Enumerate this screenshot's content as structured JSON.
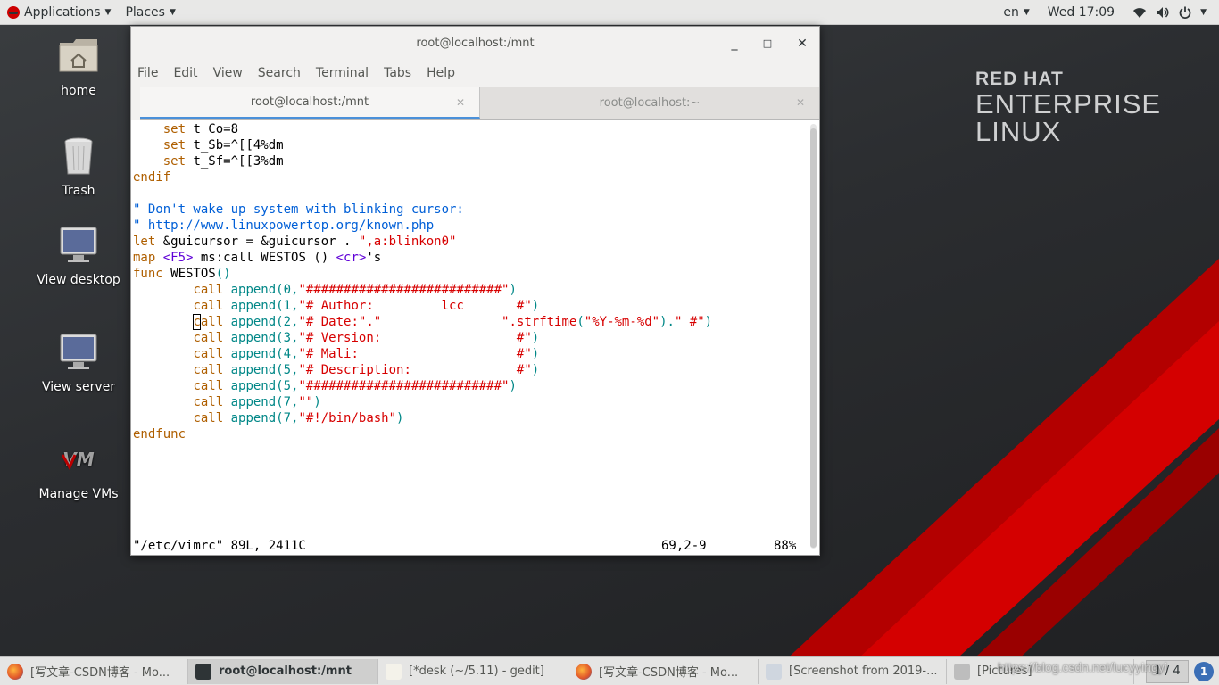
{
  "topbar": {
    "applications": "Applications",
    "places": "Places",
    "language": "en",
    "clock": "Wed 17:09"
  },
  "desktop": {
    "brand": {
      "line1": "RED HAT",
      "line2": "ENTERPRISE",
      "line3": "LINUX"
    },
    "icons": [
      {
        "label": "home",
        "icon": "home-folder-icon"
      },
      {
        "label": "Trash",
        "icon": "trash-icon"
      },
      {
        "label": "View desktop",
        "icon": "monitor-icon"
      },
      {
        "label": "View server",
        "icon": "monitor-icon"
      },
      {
        "label": "Manage VMs",
        "icon": "vm-icon"
      }
    ]
  },
  "terminal": {
    "title": "root@localhost:/mnt",
    "menu": [
      "File",
      "Edit",
      "View",
      "Search",
      "Terminal",
      "Tabs",
      "Help"
    ],
    "tabs": [
      {
        "label": "root@localhost:/mnt",
        "active": true
      },
      {
        "label": "root@localhost:~",
        "active": false
      }
    ],
    "lines": [
      [
        [
          "    ",
          "st"
        ],
        [
          "set",
          "kw"
        ],
        [
          " t_Co=8",
          "st"
        ]
      ],
      [
        [
          "    ",
          "st"
        ],
        [
          "set",
          "kw"
        ],
        [
          " t_Sb=^[[4%dm",
          "st"
        ]
      ],
      [
        [
          "    ",
          "st"
        ],
        [
          "set",
          "kw"
        ],
        [
          " t_Sf=^[[3%dm",
          "st"
        ]
      ],
      [
        [
          "endif",
          "kw"
        ]
      ],
      [
        [
          "",
          "st"
        ]
      ],
      [
        [
          "\" Don't wake up system with blinking cursor:",
          "cm"
        ]
      ],
      [
        [
          "\" http://www.linuxpowertop.org/known.php",
          "cm"
        ]
      ],
      [
        [
          "let",
          "kw"
        ],
        [
          " &guicursor = &guicursor . ",
          "st"
        ],
        [
          "\",a:blinkon0\"",
          "str"
        ]
      ],
      [
        [
          "map",
          "kw"
        ],
        [
          " ",
          "st"
        ],
        [
          "<F5>",
          "sp"
        ],
        [
          " ms:call WESTOS () ",
          "st"
        ],
        [
          "<cr>",
          "sp"
        ],
        [
          "'s",
          "st"
        ]
      ],
      [
        [
          "func",
          "kw"
        ],
        [
          " WESTOS",
          "st"
        ],
        [
          "()",
          "fn"
        ]
      ],
      [
        [
          "        ",
          "st"
        ],
        [
          "call",
          "kw"
        ],
        [
          " ",
          "st"
        ],
        [
          "append",
          "fn"
        ],
        [
          "(0,",
          "fn"
        ],
        [
          "\"##########################\"",
          "str"
        ],
        [
          ")",
          "fn"
        ]
      ],
      [
        [
          "        ",
          "st"
        ],
        [
          "call",
          "kw"
        ],
        [
          " ",
          "st"
        ],
        [
          "append",
          "fn"
        ],
        [
          "(1,",
          "fn"
        ],
        [
          "\"# Author:         lcc       #\"",
          "str"
        ],
        [
          ")",
          "fn"
        ]
      ],
      [
        [
          "        ",
          "st"
        ],
        [
          "call",
          "kw"
        ],
        [
          " ",
          "st"
        ],
        [
          "append",
          "fn"
        ],
        [
          "(2,",
          "fn"
        ],
        [
          "\"# Date:\".\"",
          "str"
        ],
        [
          "                ",
          "st"
        ],
        [
          "\".strftime",
          "str"
        ],
        [
          "(",
          "fn"
        ],
        [
          "\"%Y-%m-%d\"",
          "str"
        ],
        [
          ").",
          "fn"
        ],
        [
          "\" #\"",
          "str"
        ],
        [
          ")",
          "fn"
        ]
      ],
      [
        [
          "        ",
          "st"
        ],
        [
          "call",
          "kw"
        ],
        [
          " ",
          "st"
        ],
        [
          "append",
          "fn"
        ],
        [
          "(3,",
          "fn"
        ],
        [
          "\"# Version:                  #\"",
          "str"
        ],
        [
          ")",
          "fn"
        ]
      ],
      [
        [
          "        ",
          "st"
        ],
        [
          "call",
          "kw"
        ],
        [
          " ",
          "st"
        ],
        [
          "append",
          "fn"
        ],
        [
          "(4,",
          "fn"
        ],
        [
          "\"# Mali:                     #\"",
          "str"
        ],
        [
          ")",
          "fn"
        ]
      ],
      [
        [
          "        ",
          "st"
        ],
        [
          "call",
          "kw"
        ],
        [
          " ",
          "st"
        ],
        [
          "append",
          "fn"
        ],
        [
          "(5,",
          "fn"
        ],
        [
          "\"# Description:              #\"",
          "str"
        ],
        [
          ")",
          "fn"
        ]
      ],
      [
        [
          "        ",
          "st"
        ],
        [
          "call",
          "kw"
        ],
        [
          " ",
          "st"
        ],
        [
          "append",
          "fn"
        ],
        [
          "(5,",
          "fn"
        ],
        [
          "\"##########################\"",
          "str"
        ],
        [
          ")",
          "fn"
        ]
      ],
      [
        [
          "        ",
          "st"
        ],
        [
          "call",
          "kw"
        ],
        [
          " ",
          "st"
        ],
        [
          "append",
          "fn"
        ],
        [
          "(7,",
          "fn"
        ],
        [
          "\"\"",
          "str"
        ],
        [
          ")",
          "fn"
        ]
      ],
      [
        [
          "        ",
          "st"
        ],
        [
          "call",
          "kw"
        ],
        [
          " ",
          "st"
        ],
        [
          "append",
          "fn"
        ],
        [
          "(7,",
          "fn"
        ],
        [
          "\"#!/bin/bash\"",
          "str"
        ],
        [
          ")",
          "fn"
        ]
      ],
      [
        [
          "endfunc",
          "kw"
        ]
      ]
    ],
    "status_file": "\"/etc/vimrc\" 89L, 2411C",
    "status_pos": "69,2-9",
    "status_pct": "88%",
    "scroll_fraction": 0.88
  },
  "taskbar": {
    "tasks": [
      {
        "label": "[写文章-CSDN博客 - Mo...",
        "icon": "firefox-icon",
        "active": false
      },
      {
        "label": "root@localhost:/mnt",
        "icon": "terminal-icon",
        "active": true
      },
      {
        "label": "[*desk (~/5.11) - gedit]",
        "icon": "gedit-icon",
        "active": false
      },
      {
        "label": "[写文章-CSDN博客 - Mo...",
        "icon": "firefox-icon",
        "active": false
      },
      {
        "label": "[Screenshot from 2019-...",
        "icon": "screenshot-icon",
        "active": false
      },
      {
        "label": "[Pictures]",
        "icon": "files-icon",
        "active": false
      }
    ],
    "pager": "1 / 4",
    "notification": "1",
    "watermark": "https://blog.csdn.net/lucyyingyi"
  },
  "colors": {
    "accent_tab": "#4a90d9",
    "keyword": "#af5f00",
    "comment": "#005fd7",
    "string": "#d70000",
    "function": "#008787",
    "special": "#5f00d7",
    "stripe_red": "#c40000"
  }
}
